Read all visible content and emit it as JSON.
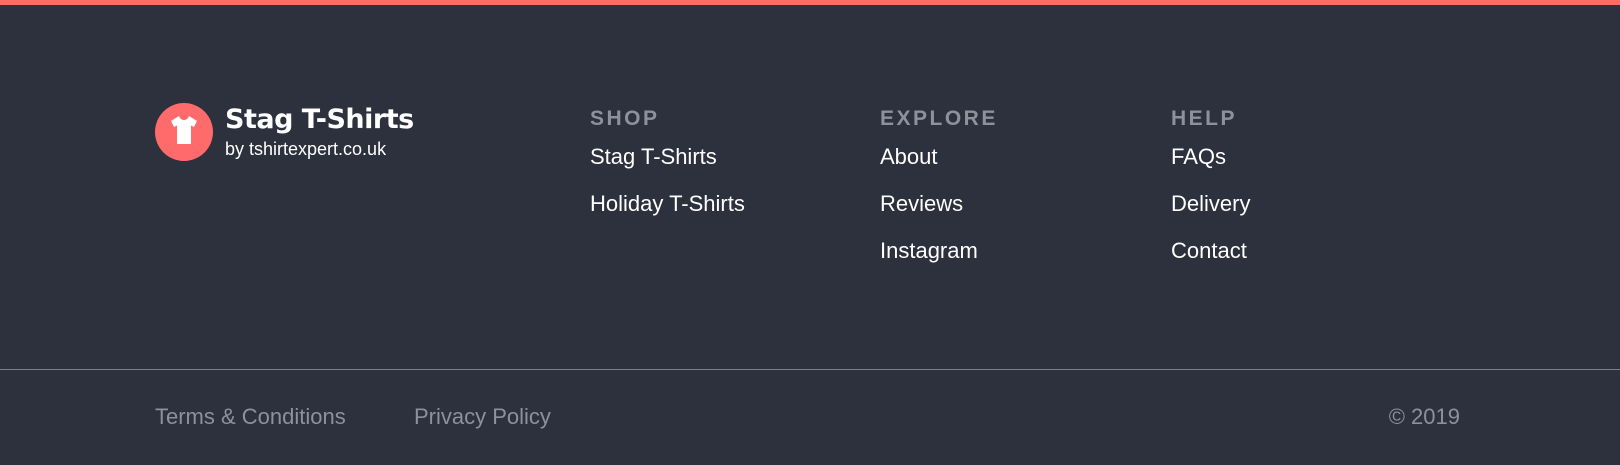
{
  "colors": {
    "accent": "#ff6b6b",
    "background": "#2d303d",
    "muted_text": "#8b929c",
    "text": "#ffffff",
    "divider": "#7b7f8b"
  },
  "brand": {
    "logo_icon": "t-shirt-icon",
    "title": "Stag T-Shirts",
    "subtitle": "by tshirtexpert.co.uk"
  },
  "columns": {
    "shop": {
      "heading": "SHOP",
      "links": [
        "Stag T-Shirts",
        "Holiday T-Shirts"
      ]
    },
    "explore": {
      "heading": "EXPLORE",
      "links": [
        "About",
        "Reviews",
        "Instagram"
      ]
    },
    "help": {
      "heading": "HELP",
      "links": [
        "FAQs",
        "Delivery",
        "Contact"
      ]
    }
  },
  "bottom": {
    "terms": "Terms & Conditions",
    "privacy": "Privacy Policy",
    "copyright": "© 2019"
  }
}
